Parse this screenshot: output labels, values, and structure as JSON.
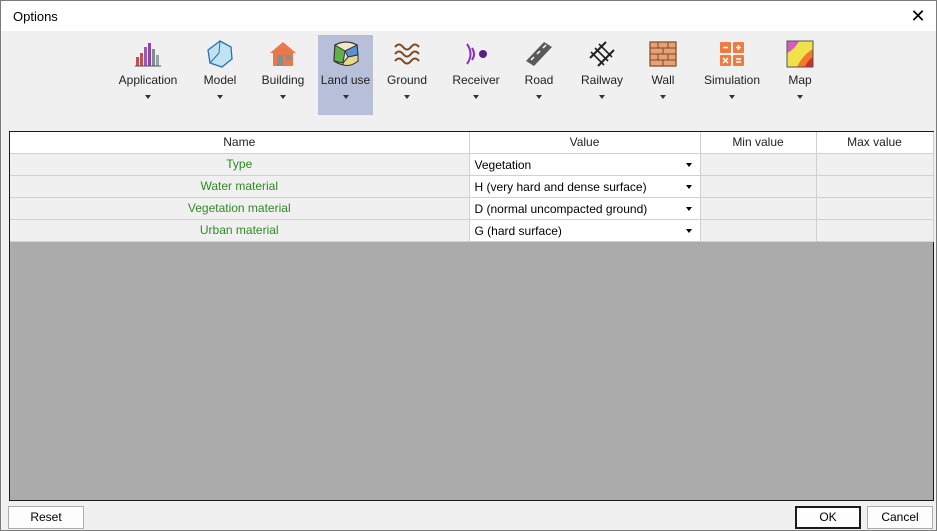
{
  "window": {
    "title": "Options",
    "close_label": "✕"
  },
  "toolbar": {
    "items": [
      {
        "label": "Application",
        "icon": "bar-chart-icon",
        "active": false
      },
      {
        "label": "Model",
        "icon": "mesh-icon",
        "active": false
      },
      {
        "label": "Building",
        "icon": "house-icon",
        "active": false
      },
      {
        "label": "Land use",
        "icon": "land-use-icon",
        "active": true
      },
      {
        "label": "Ground",
        "icon": "ground-waves-icon",
        "active": false
      },
      {
        "label": "Receiver",
        "icon": "receiver-icon",
        "active": false
      },
      {
        "label": "Road",
        "icon": "road-icon",
        "active": false
      },
      {
        "label": "Railway",
        "icon": "railway-icon",
        "active": false
      },
      {
        "label": "Wall",
        "icon": "brick-wall-icon",
        "active": false
      },
      {
        "label": "Simulation",
        "icon": "calculator-icon",
        "active": false
      },
      {
        "label": "Map",
        "icon": "map-icon",
        "active": false
      }
    ]
  },
  "grid": {
    "headers": {
      "name": "Name",
      "value": "Value",
      "min": "Min value",
      "max": "Max value"
    },
    "rows": [
      {
        "name": "Type",
        "value": "Vegetation",
        "min": "",
        "max": ""
      },
      {
        "name": "Water material",
        "value": "H (very hard and dense surface)",
        "min": "",
        "max": ""
      },
      {
        "name": "Vegetation material",
        "value": "D (normal uncompacted ground)",
        "min": "",
        "max": ""
      },
      {
        "name": "Urban material",
        "value": "G (hard surface)",
        "min": "",
        "max": ""
      }
    ]
  },
  "footer": {
    "reset_label": "Reset",
    "ok_label": "OK",
    "cancel_label": "Cancel"
  },
  "colors": {
    "name_text": "#2e8b22",
    "active_tab": "#b8bfd9",
    "empty_grid": "#ababab"
  }
}
